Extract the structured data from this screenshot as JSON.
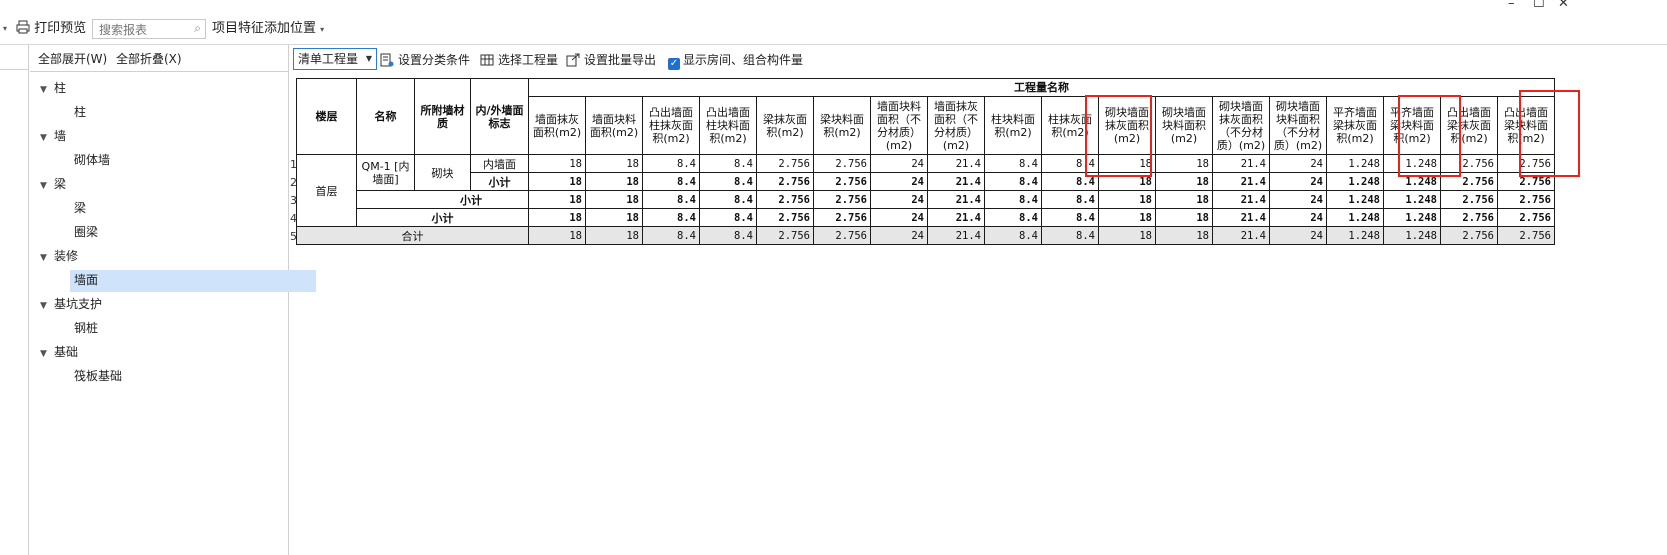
{
  "toolbar1": {
    "print_preview": "打印预览",
    "search_placeholder": "搜索报表",
    "item_feature": "项目特征添加位置"
  },
  "tree": {
    "expand_all": "全部展开(W)",
    "collapse_all": "全部折叠(X)",
    "nodes": [
      {
        "label": "柱",
        "level": 0
      },
      {
        "label": "柱",
        "level": 1
      },
      {
        "label": "墙",
        "level": 0
      },
      {
        "label": "砌体墙",
        "level": 1
      },
      {
        "label": "梁",
        "level": 0
      },
      {
        "label": "梁",
        "level": 1
      },
      {
        "label": "圈梁",
        "level": 1
      },
      {
        "label": "装修",
        "level": 0
      },
      {
        "label": "墙面",
        "level": 1,
        "selected": true
      },
      {
        "label": "基坑支护",
        "level": 0
      },
      {
        "label": "钢桩",
        "level": 1
      },
      {
        "label": "基础",
        "level": 0
      },
      {
        "label": "筏板基础",
        "level": 1
      }
    ]
  },
  "toolbar2": {
    "combo_value": "清单工程量",
    "set_category": "设置分类条件",
    "select_quantity": "选择工程量",
    "batch_export": "设置批量导出",
    "show_rooms": "显示房间、组合构件量"
  },
  "table": {
    "h_floor": "楼层",
    "h_name": "名称",
    "h_material": "所附墙材质",
    "h_side": "内/外墙面标志",
    "h_group": "工程量名称",
    "columns": [
      "墙面抹灰面积(m2)",
      "墙面块料面积(m2)",
      "凸出墙面柱抹灰面积(m2)",
      "凸出墙面柱块料面积(m2)",
      "梁抹灰面积(m2)",
      "梁块料面积(m2)",
      "墙面块料面积（不分材质）(m2)",
      "墙面抹灰面积（不分材质）(m2)",
      "柱块料面积(m2)",
      "柱抹灰面积(m2)",
      "砌块墙面抹灰面积(m2)",
      "砌块墙面块料面积(m2)",
      "砌块墙面抹灰面积（不分材质）(m2)",
      "砌块墙面块料面积（不分材质）(m2)",
      "平齐墙面梁抹灰面积(m2)",
      "平齐墙面梁块料面积(m2)",
      "凸出墙面梁抹灰面积(m2)",
      "凸出墙面梁块料面积(m2)"
    ],
    "floor": "首层",
    "name": "QM-1 [内墙面]",
    "material": "砌块",
    "side": "内墙面",
    "subtotal": "小计",
    "total": "合计",
    "row_numbers": [
      "1",
      "2",
      "3",
      "4",
      "5"
    ],
    "values": [
      "18",
      "18",
      "8.4",
      "8.4",
      "2.756",
      "2.756",
      "24",
      "21.4",
      "8.4",
      "8.4",
      "18",
      "18",
      "21.4",
      "24",
      "1.248",
      "1.248",
      "2.756",
      "2.756"
    ]
  }
}
